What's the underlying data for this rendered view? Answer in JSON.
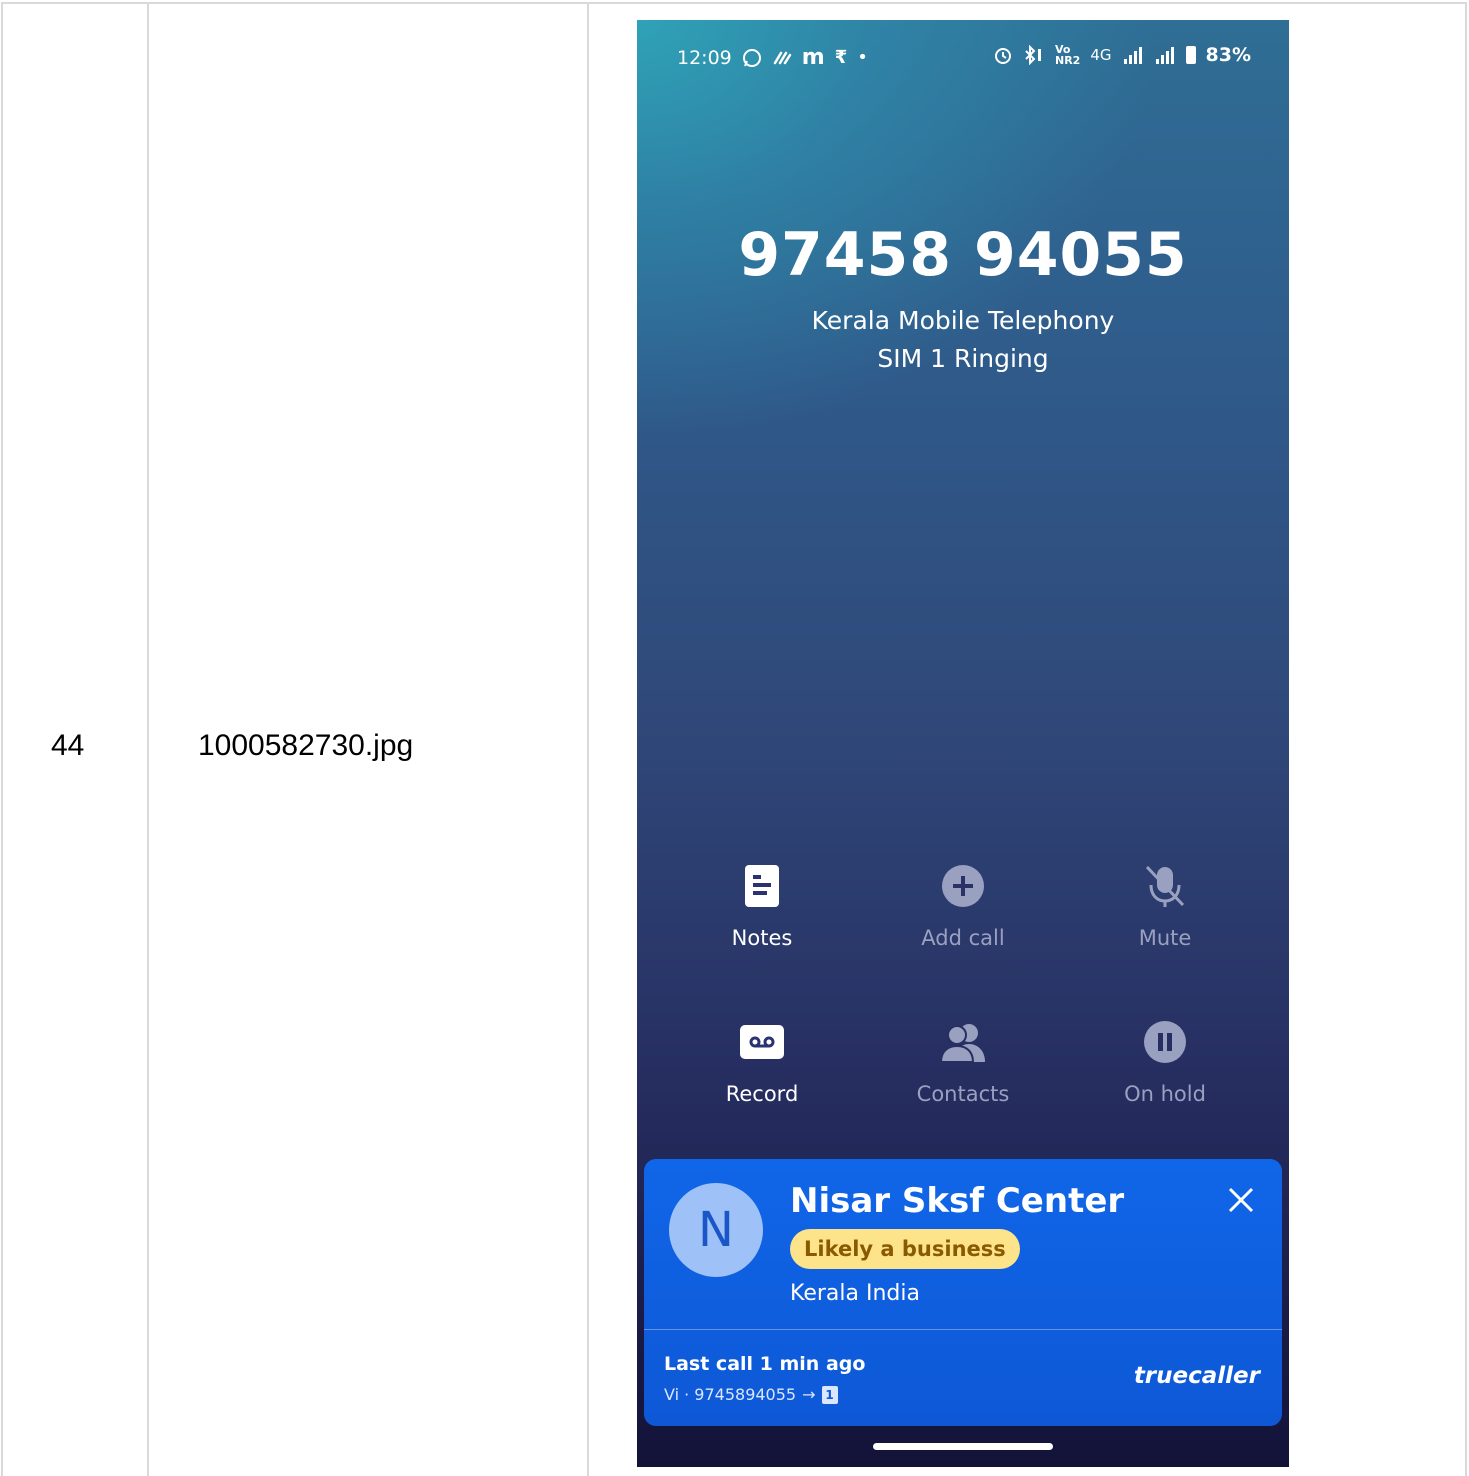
{
  "row": {
    "index": "44",
    "filename": "1000582730.jpg"
  },
  "status_bar": {
    "time": "12:09",
    "left_icons": [
      "whatsapp-icon",
      "app-icon",
      "m-icon",
      "rupee-icon",
      "dot-icon"
    ],
    "right_icons": [
      "alarm-icon",
      "bluetooth-icon",
      "volte-icon",
      "signal-4g-icon",
      "signal-icon",
      "battery-icon"
    ],
    "network": "4G",
    "battery": "83%"
  },
  "call": {
    "number": "97458 94055",
    "carrier": "Kerala Mobile Telephony",
    "status": "SIM 1 Ringing"
  },
  "actions": [
    {
      "label": "Notes",
      "icon": "notes-icon",
      "enabled": true
    },
    {
      "label": "Add call",
      "icon": "add-call-icon",
      "enabled": false
    },
    {
      "label": "Mute",
      "icon": "mute-icon",
      "enabled": false
    },
    {
      "label": "Record",
      "icon": "record-icon",
      "enabled": true
    },
    {
      "label": "Contacts",
      "icon": "contacts-icon",
      "enabled": false
    },
    {
      "label": "On hold",
      "icon": "hold-icon",
      "enabled": false
    }
  ],
  "caller_id": {
    "avatar_letter": "N",
    "name": "Nisar Sksf Center",
    "badge": "Likely a business",
    "location": "Kerala India",
    "last_call": "Last call 1 min ago",
    "last_call_detail": "Vi · 9745894055",
    "sim_number": "1",
    "brand": "truecaller",
    "colors": {
      "card": "#0e58d6",
      "badge_bg": "#fde38a",
      "badge_text": "#8a5a00",
      "avatar_bg": "#9ec2f7"
    }
  }
}
